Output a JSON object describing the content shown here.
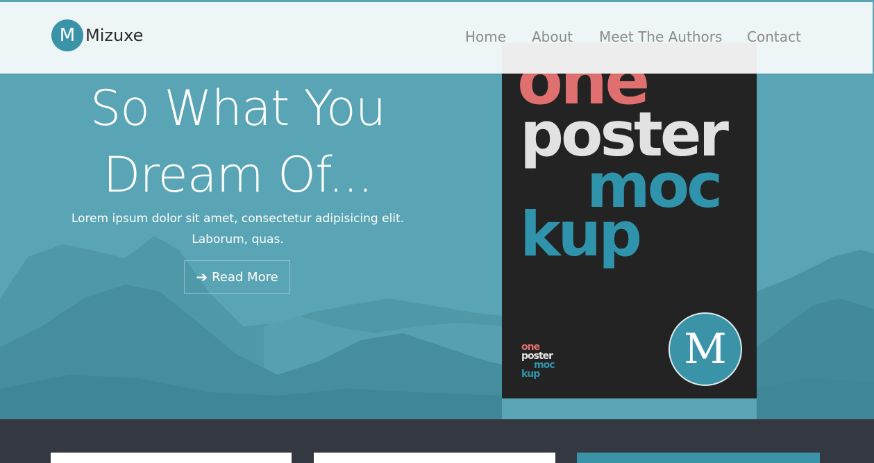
{
  "colors": {
    "accent": "#3a93a7",
    "hero_bg": "#5aa5b5",
    "navbar_bg": "#edf5f6",
    "footer_band": "#343840",
    "poster_bg": "#232323",
    "poster_pink": "#e07070",
    "poster_teal": "#2f94ab"
  },
  "brand": {
    "logo_letter": "M",
    "name": "Mizuxe"
  },
  "nav": {
    "home": "Home",
    "about": "About",
    "authors": "Meet The Authors",
    "contact": "Contact"
  },
  "hero": {
    "title_line1": "So What You",
    "title_line2": "Dream Of...",
    "subtitle_line1": "Lorem ipsum dolor sit amet, consectetur adipisicing elit.",
    "subtitle_line2": "Laborum, quas.",
    "button_icon": "arrow-right-icon",
    "button_label": "Read More"
  },
  "poster": {
    "word_one": "one",
    "word_poster": "poster",
    "word_moc": "moc",
    "word_kup": "kup",
    "badge_letter": "M"
  }
}
